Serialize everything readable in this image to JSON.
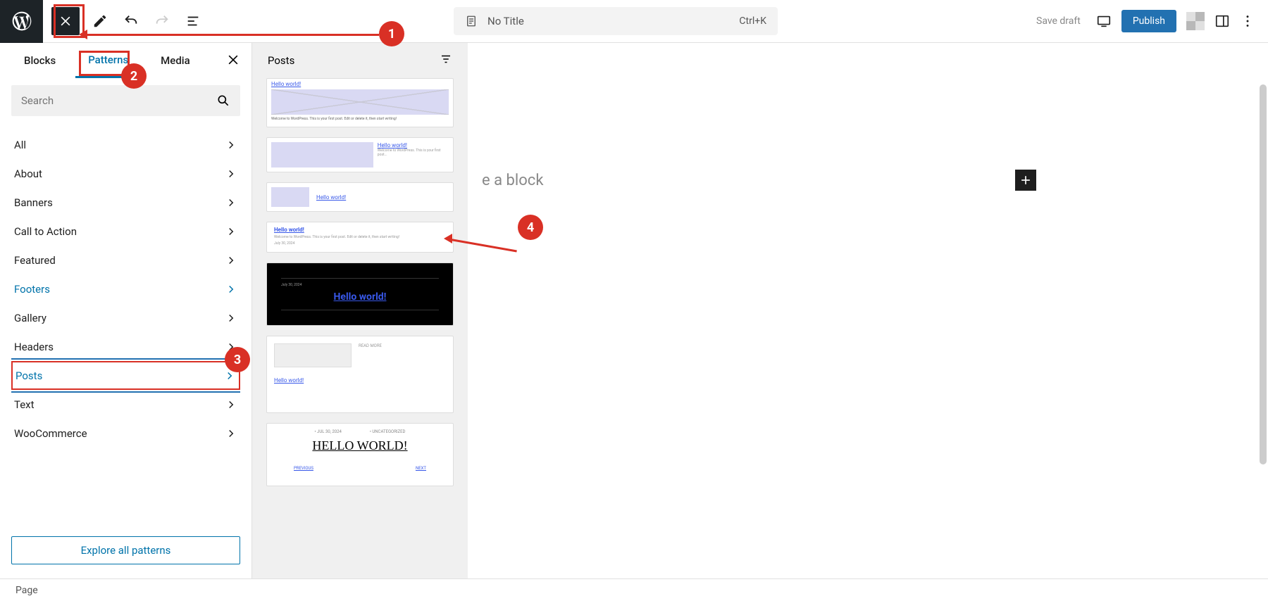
{
  "topbar": {
    "title": "No Title",
    "shortcut": "Ctrl+K",
    "save_draft": "Save draft",
    "publish": "Publish"
  },
  "tabs": {
    "blocks": "Blocks",
    "patterns": "Patterns",
    "media": "Media"
  },
  "search": {
    "placeholder": "Search"
  },
  "categories": [
    {
      "label": "All"
    },
    {
      "label": "About"
    },
    {
      "label": "Banners"
    },
    {
      "label": "Call to Action"
    },
    {
      "label": "Featured"
    },
    {
      "label": "Footers"
    },
    {
      "label": "Gallery"
    },
    {
      "label": "Headers"
    },
    {
      "label": "Posts"
    },
    {
      "label": "Text"
    },
    {
      "label": "WooCommerce"
    }
  ],
  "explore": "Explore all patterns",
  "preview_panel": {
    "title": "Posts"
  },
  "previews": {
    "p1": {
      "title": "Hello world!",
      "text": "Welcome to WordPress. This is your first post. Edit or delete it, then start writing!"
    },
    "p2": {
      "title": "Hello world!",
      "text": "Welcome to WordPress. This is your first post..."
    },
    "p3": {
      "title": "Hello world!"
    },
    "p4": {
      "title": "Hello world!",
      "sub1": "Welcome to WordPress. This is your first post. Edit or delete it, then start writing!",
      "sub2": "July 30, 2024"
    },
    "p5": {
      "date": "July 30, 2024",
      "title": "Hello world!"
    },
    "p6": {
      "small": "READ MORE",
      "title": "Hello world!"
    },
    "p7": {
      "date": "• JUL 30, 2024",
      "cat": "• UNCATEGORIZED",
      "title": "HELLO WORLD!",
      "prev": "PREVIOUS",
      "next": "NEXT"
    }
  },
  "canvas": {
    "placeholder": "e a block"
  },
  "footer": {
    "type": "Page"
  },
  "annotations": {
    "n1": "1",
    "n2": "2",
    "n3": "3",
    "n4": "4"
  }
}
